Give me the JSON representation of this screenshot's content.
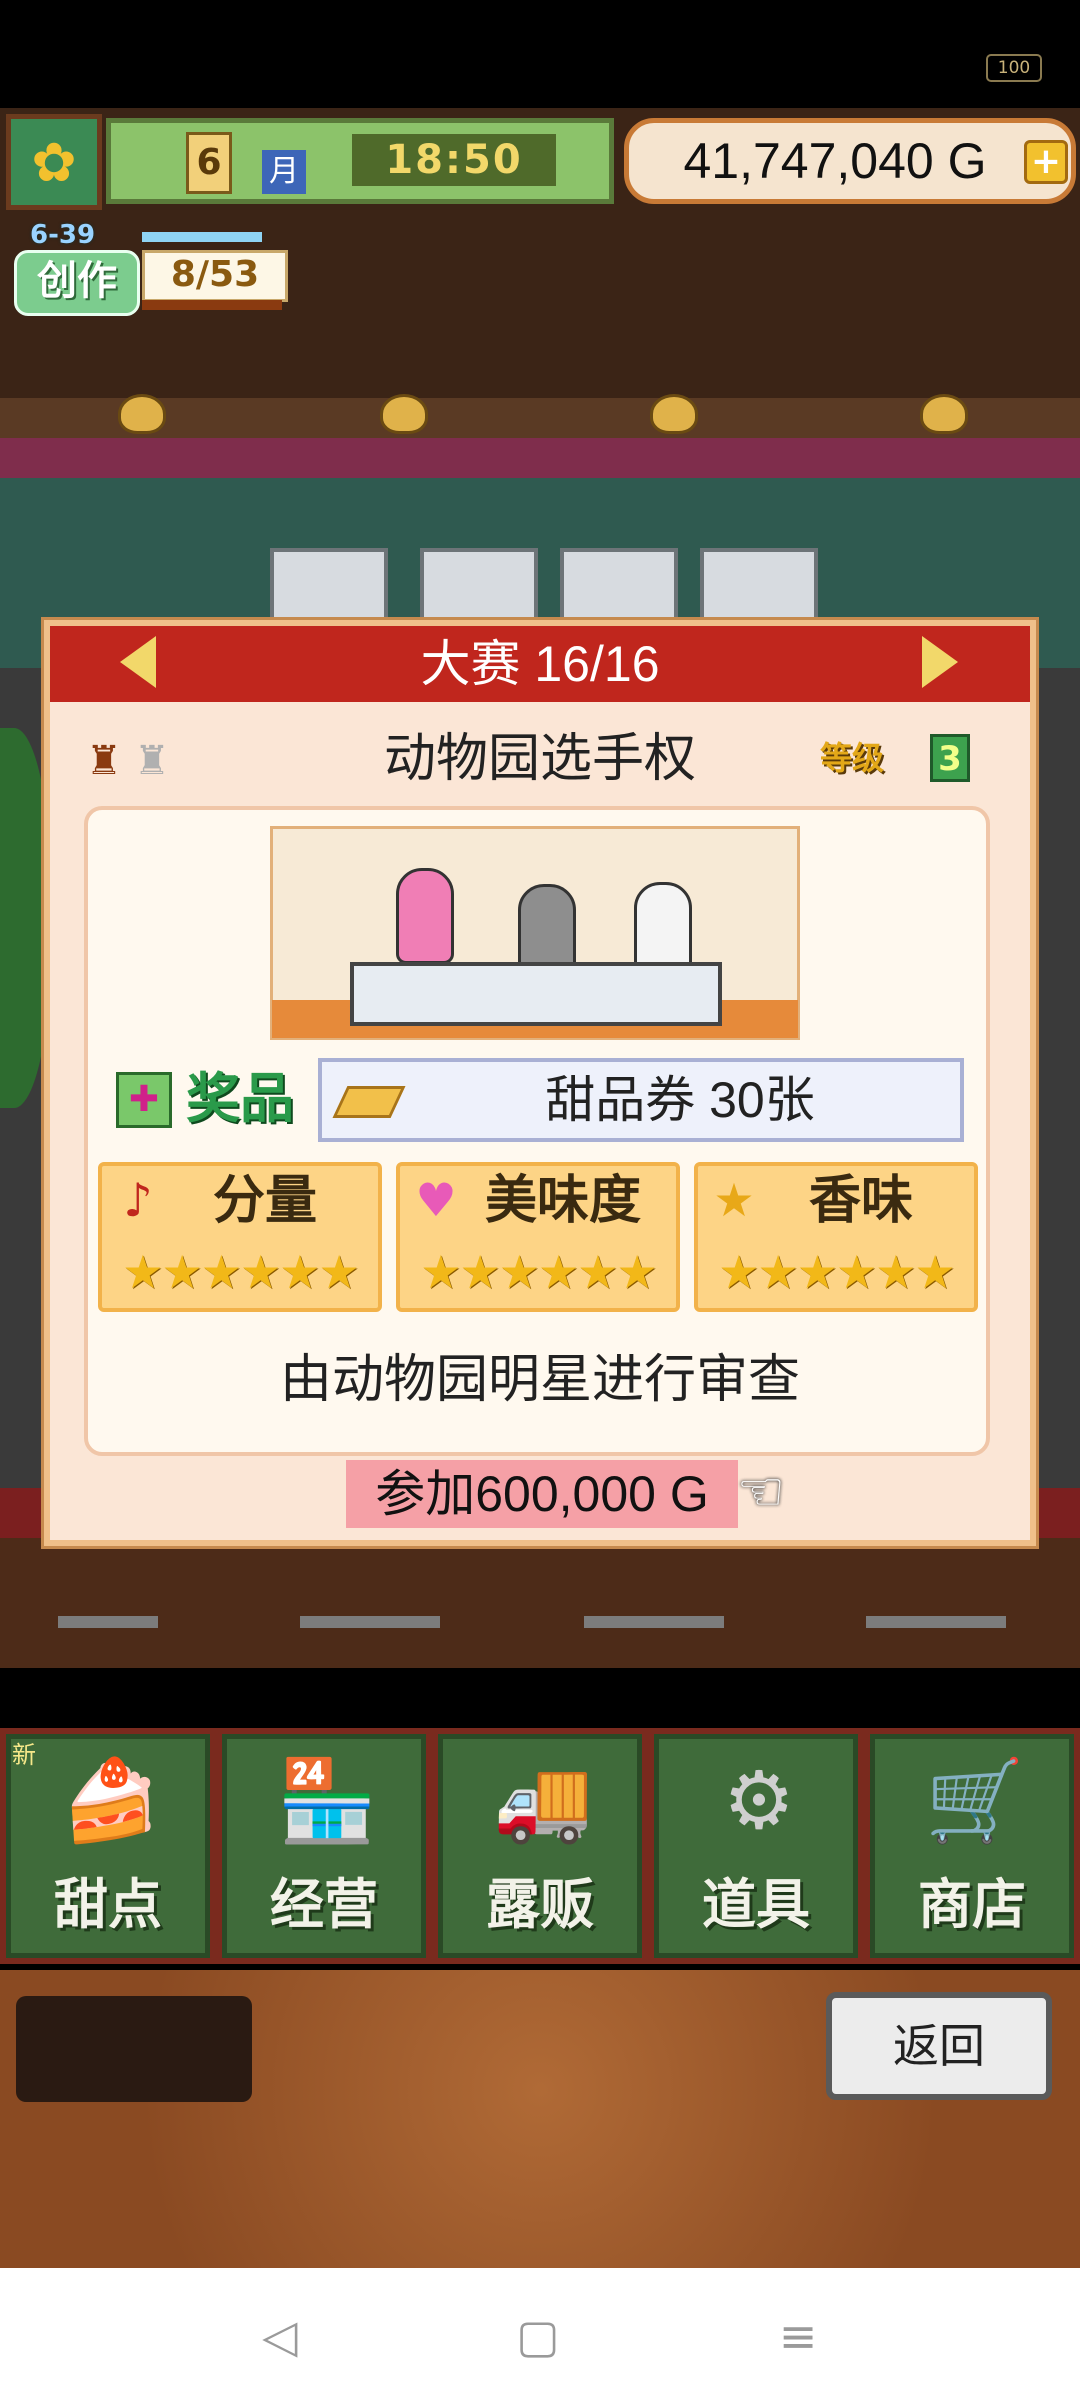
{
  "status_bar": {
    "battery": "100"
  },
  "hud": {
    "month_number": "6",
    "month_label": "月",
    "time": "18:50",
    "money": "41,747,040 G",
    "money_plus": "+",
    "create_date": "6-39",
    "create_label": "创作",
    "create_count": "8/53",
    "create_progress": 0.15
  },
  "dialog": {
    "title": "大赛 16/16",
    "contest_name": "动物园选手权",
    "level_label": "等级",
    "level_value": "3",
    "prize_label": "奖品",
    "prize_text": "甜品券 30张",
    "stats": [
      {
        "name": "分量",
        "icon": "music-note-icon",
        "icon_glyph": "♪",
        "icon_color": "#c0261d",
        "stars": 6,
        "stars_text": "★★★★★★"
      },
      {
        "name": "美味度",
        "icon": "heart-icon",
        "icon_glyph": "♥",
        "icon_color": "#e85ab8",
        "stars": 6,
        "stars_text": "★★★★★★"
      },
      {
        "name": "香味",
        "icon": "star-icon",
        "icon_glyph": "★",
        "icon_color": "#e8a818",
        "stars": 6,
        "stars_text": "★★★★★★"
      }
    ],
    "judge_text": "由动物园明星进行审查",
    "join_button": "参加600,000 G"
  },
  "menu": {
    "new_badge": "新",
    "items": [
      {
        "label": "甜点",
        "icon": "cake-icon",
        "glyph": "🍰"
      },
      {
        "label": "经营",
        "icon": "shop-icon",
        "glyph": "🏪"
      },
      {
        "label": "露贩",
        "icon": "food-truck-icon",
        "glyph": "🚚"
      },
      {
        "label": "道具",
        "icon": "gear-bag-icon",
        "glyph": "⚙"
      },
      {
        "label": "商店",
        "icon": "cart-icon",
        "glyph": "🛒"
      }
    ]
  },
  "bottom": {
    "back_button": "返回"
  },
  "nav": {
    "back": "◁",
    "home": "▢",
    "menu": "≡"
  },
  "colors": {
    "header_red": "#c0261d",
    "star_gold": "#f2b818",
    "menu_green": "#3f6b3a",
    "join_pink": "#f5a0a6"
  }
}
